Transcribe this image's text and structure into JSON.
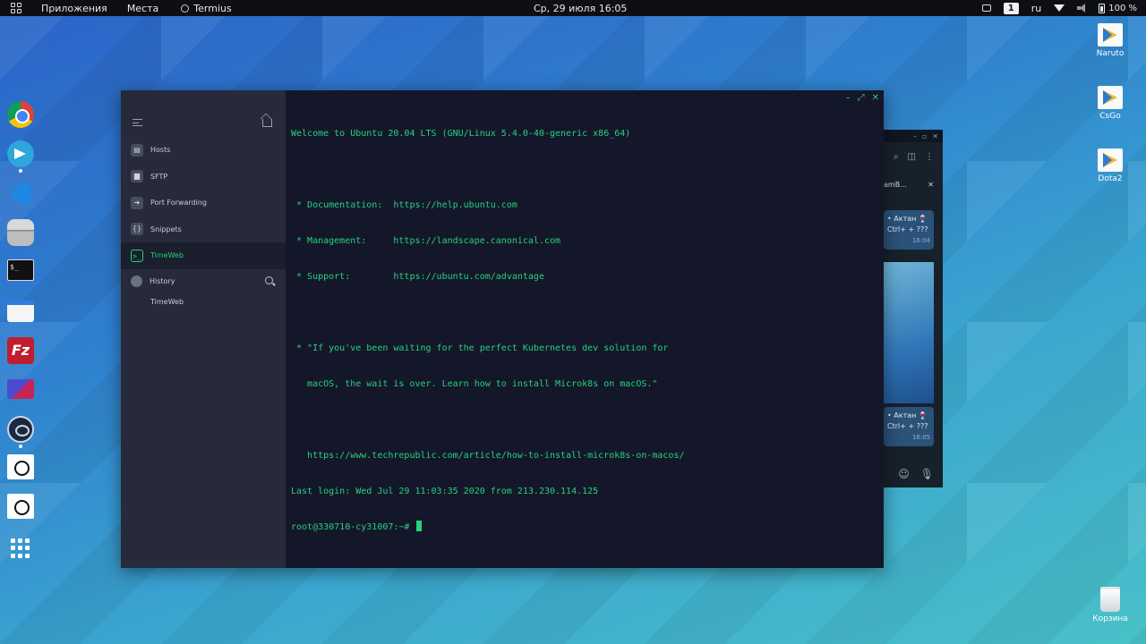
{
  "topbar": {
    "apps_label": "Приложения",
    "places_label": "Места",
    "active_app": "Termius",
    "clock": "Ср, 29 июля  16:05",
    "workspace": "1",
    "keyboard_layout": "ru",
    "battery": "100 %"
  },
  "dock": {
    "items": [
      "chrome-icon",
      "telegram-icon",
      "vscode-icon",
      "disks-icon",
      "terminal-icon",
      "files-icon",
      "filezilla-icon",
      "rdp-icon",
      "mega-icon",
      "monitor-icon",
      "monitor-icon",
      "show-apps-icon"
    ],
    "terminal_glyph": "$_",
    "filezilla_glyph": "Fz"
  },
  "desktop": {
    "icons": [
      {
        "label": "Naruto",
        "icon": "shortcut-icon"
      },
      {
        "label": "CsGo",
        "icon": "shortcut-icon"
      },
      {
        "label": "Dota2",
        "icon": "shortcut-icon"
      },
      {
        "label": "Корзина",
        "icon": "trash-icon"
      }
    ]
  },
  "telegram": {
    "tab_label": "amB...",
    "msg1_text": "• Актан 🍷\nCtrl+ + ???",
    "msg1_time": "16:04",
    "msg2_text": "• Актан 🍷\nCtrl+ + ???",
    "msg2_time": "16:05"
  },
  "sidebar": {
    "items": [
      {
        "label": "Hosts",
        "icon": "hosts-icon",
        "glyph": "▤"
      },
      {
        "label": "SFTP",
        "icon": "folder-icon",
        "glyph": "▆"
      },
      {
        "label": "Port Forwarding",
        "icon": "forward-icon",
        "glyph": "➜"
      },
      {
        "label": "Snippets",
        "icon": "braces-icon",
        "glyph": "{}"
      },
      {
        "label": "TimeWeb",
        "icon": "terminal-prompt-icon",
        "glyph": ">_"
      }
    ],
    "history_label": "History",
    "history_items": [
      "TimeWeb"
    ]
  },
  "window_controls": [
    "–",
    "⤢",
    "✕"
  ],
  "terminal": {
    "lines": [
      "Welcome to Ubuntu 20.04 LTS (GNU/Linux 5.4.0-40-generic x86_64)",
      "",
      " * Documentation:  https://help.ubuntu.com",
      " * Management:     https://landscape.canonical.com",
      " * Support:        https://ubuntu.com/advantage",
      "",
      " * \"If you've been waiting for the perfect Kubernetes dev solution for",
      "   macOS, the wait is over. Learn how to install Microk8s on macOS.\"",
      "",
      "   https://www.techrepublic.com/article/how-to-install-microk8s-on-macos/",
      "Last login: Wed Jul 29 11:03:35 2020 from 213.230.114.125",
      "root@330710-cy31007:~# "
    ],
    "color": "#27d17f"
  }
}
